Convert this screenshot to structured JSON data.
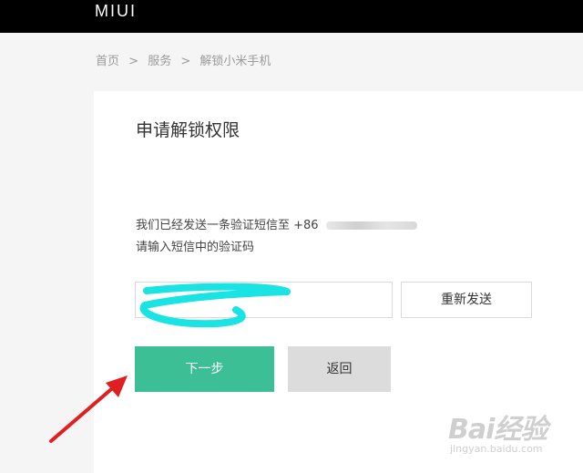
{
  "header": {
    "logo": "MIUI"
  },
  "breadcrumb": {
    "items": [
      "首页",
      "服务",
      "解锁小米手机"
    ],
    "separator": ">"
  },
  "form": {
    "title": "申请解锁权限",
    "message_line1": "我们已经发送一条验证短信至 +86",
    "message_line2": "请输入短信中的验证码",
    "code_value": "",
    "resend_label": "重新发送",
    "next_label": "下一步",
    "back_label": "返回"
  },
  "watermark": {
    "brand": "Bai经验",
    "url": "jingyan.baidu.com"
  },
  "colors": {
    "topbar": "#000000",
    "primary": "#3dbf95",
    "secondary": "#dcdcdc",
    "annotation": "#e02020"
  }
}
